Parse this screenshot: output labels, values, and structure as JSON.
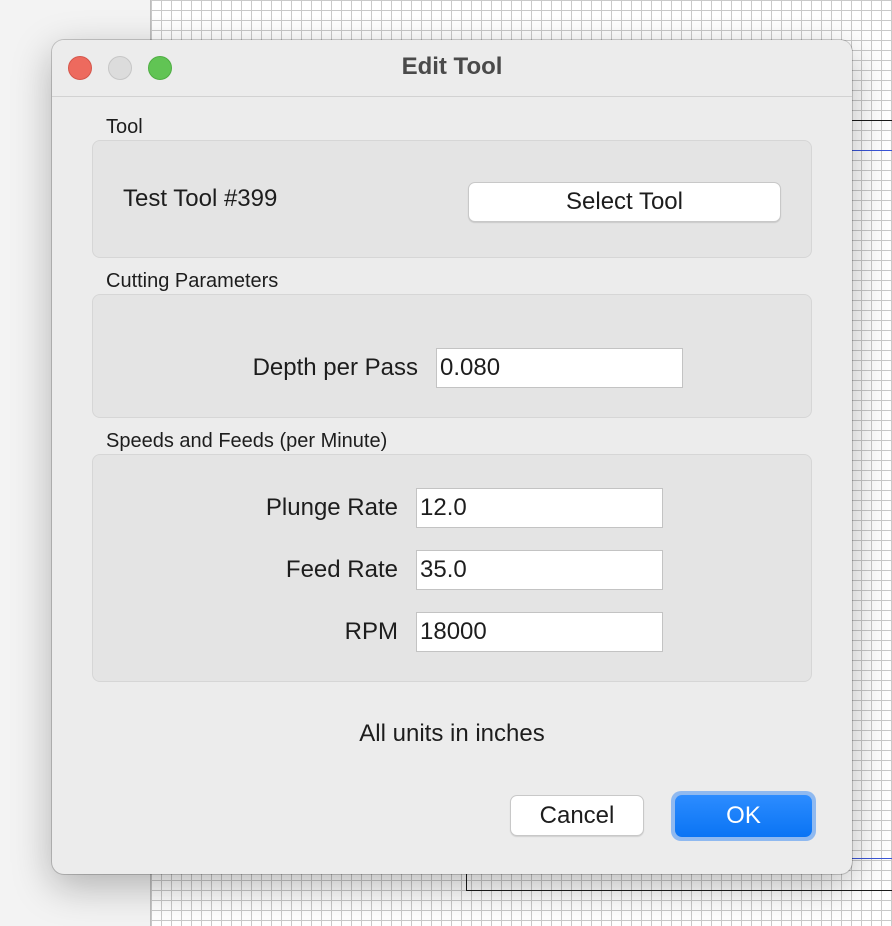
{
  "window": {
    "title": "Edit Tool"
  },
  "tool_section": {
    "label": "Tool",
    "tool_name": "Test Tool #399",
    "select_button": "Select Tool"
  },
  "cutting_section": {
    "label": "Cutting Parameters",
    "depth_label": "Depth per Pass",
    "depth_value": "0.080"
  },
  "speeds_section": {
    "label": "Speeds and Feeds (per Minute)",
    "plunge_label": "Plunge Rate",
    "plunge_value": "12.0",
    "feed_label": "Feed Rate",
    "feed_value": "35.0",
    "rpm_label": "RPM",
    "rpm_value": "18000"
  },
  "units_note": "All units in inches",
  "buttons": {
    "cancel": "Cancel",
    "ok": "OK"
  },
  "colors": {
    "close": "#ed6a5e",
    "minimize": "#dcdcdc",
    "zoom": "#61c454",
    "accent": "#0a74f4"
  }
}
